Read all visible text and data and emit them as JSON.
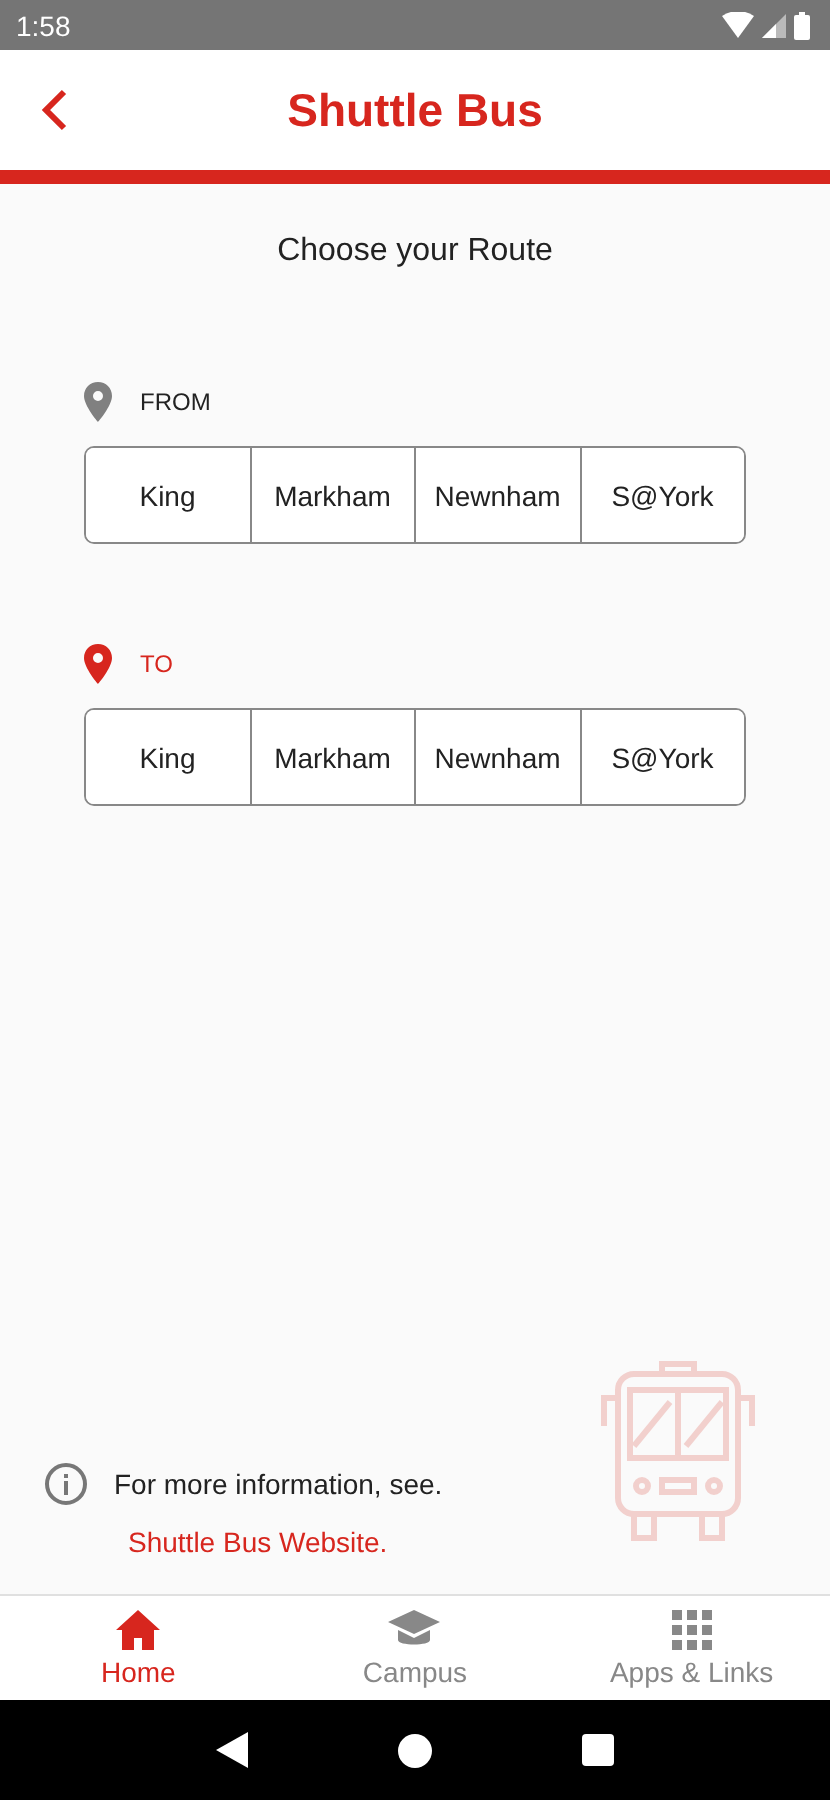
{
  "status_bar": {
    "time": "1:58"
  },
  "header": {
    "title": "Shuttle Bus"
  },
  "prompt": "Choose your Route",
  "pickers": [
    {
      "label": "FROM",
      "selected": false,
      "options": [
        {
          "label": "King",
          "selected": false
        },
        {
          "label": "Markham",
          "selected": false
        },
        {
          "label": "Newnham",
          "selected": false
        },
        {
          "label": "S@York",
          "selected": false
        }
      ]
    },
    {
      "label": "TO",
      "selected": true,
      "options": [
        {
          "label": "King",
          "selected": false
        },
        {
          "label": "Markham",
          "selected": false
        },
        {
          "label": "Newnham",
          "selected": false
        },
        {
          "label": "S@York",
          "selected": false
        }
      ]
    }
  ],
  "info": {
    "text": "For more information, see.",
    "link": "Shuttle Bus Website."
  },
  "bottom_nav": [
    {
      "label": "Home",
      "kind": "home",
      "selected": true
    },
    {
      "label": "Campus",
      "kind": "campus",
      "selected": false
    },
    {
      "label": "Apps & Links",
      "kind": "apps",
      "selected": false
    }
  ]
}
